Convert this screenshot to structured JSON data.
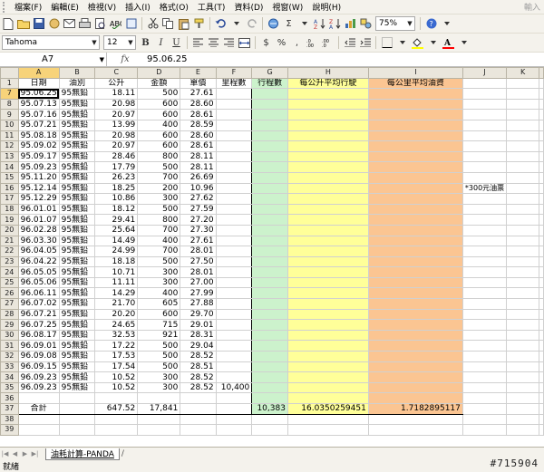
{
  "menubar": {
    "items": [
      "檔案(F)",
      "編輯(E)",
      "檢視(V)",
      "插入(I)",
      "格式(O)",
      "工具(T)",
      "資料(D)",
      "視窗(W)",
      "說明(H)"
    ],
    "ask_placeholder": "輸入"
  },
  "toolbar1": {
    "sigma": "Σ",
    "zoom": "75%"
  },
  "toolbar2": {
    "font": "Tahoma",
    "size": "12",
    "bold": "B",
    "italic": "I",
    "underline": "U",
    "currency": "$",
    "percent": "%",
    "comma": ","
  },
  "formula_bar": {
    "name_box": "A7",
    "fx": "fx",
    "formula": "95.06.25"
  },
  "grid": {
    "columns": [
      "A",
      "B",
      "C",
      "D",
      "E",
      "F",
      "G",
      "H",
      "I",
      "J",
      "K"
    ],
    "header_row": {
      "row": "1",
      "cells": [
        "日期",
        "油別",
        "公升",
        "金額",
        "單價",
        "里程數",
        "行程數",
        "每公升平均行駛",
        "每公里平均油資",
        "",
        ""
      ]
    },
    "rows": [
      {
        "row": "7",
        "date": "95.06.25",
        "fuel": "95無鉛",
        "liters": "18.11",
        "amount": "500",
        "price": "27.61",
        "mileage": "",
        "note": ""
      },
      {
        "row": "8",
        "date": "95.07.13",
        "fuel": "95無鉛",
        "liters": "20.98",
        "amount": "600",
        "price": "28.60",
        "mileage": "",
        "note": ""
      },
      {
        "row": "9",
        "date": "95.07.16",
        "fuel": "95無鉛",
        "liters": "20.97",
        "amount": "600",
        "price": "28.61",
        "mileage": "",
        "note": ""
      },
      {
        "row": "10",
        "date": "95.07.21",
        "fuel": "95無鉛",
        "liters": "13.99",
        "amount": "400",
        "price": "28.59",
        "mileage": "",
        "note": ""
      },
      {
        "row": "11",
        "date": "95.08.18",
        "fuel": "95無鉛",
        "liters": "20.98",
        "amount": "600",
        "price": "28.60",
        "mileage": "",
        "note": ""
      },
      {
        "row": "12",
        "date": "95.09.02",
        "fuel": "95無鉛",
        "liters": "20.97",
        "amount": "600",
        "price": "28.61",
        "mileage": "",
        "note": ""
      },
      {
        "row": "13",
        "date": "95.09.17",
        "fuel": "95無鉛",
        "liters": "28.46",
        "amount": "800",
        "price": "28.11",
        "mileage": "",
        "note": ""
      },
      {
        "row": "14",
        "date": "95.09.23",
        "fuel": "95無鉛",
        "liters": "17.79",
        "amount": "500",
        "price": "28.11",
        "mileage": "",
        "note": ""
      },
      {
        "row": "15",
        "date": "95.11.20",
        "fuel": "95無鉛",
        "liters": "26.23",
        "amount": "700",
        "price": "26.69",
        "mileage": "",
        "note": ""
      },
      {
        "row": "16",
        "date": "95.12.14",
        "fuel": "95無鉛",
        "liters": "18.25",
        "amount": "200",
        "price": "10.96",
        "mileage": "",
        "note": "*300元油票"
      },
      {
        "row": "17",
        "date": "95.12.29",
        "fuel": "95無鉛",
        "liters": "10.86",
        "amount": "300",
        "price": "27.62",
        "mileage": "",
        "note": ""
      },
      {
        "row": "18",
        "date": "96.01.01",
        "fuel": "95無鉛",
        "liters": "18.12",
        "amount": "500",
        "price": "27.59",
        "mileage": "",
        "note": ""
      },
      {
        "row": "19",
        "date": "96.01.07",
        "fuel": "95無鉛",
        "liters": "29.41",
        "amount": "800",
        "price": "27.20",
        "mileage": "",
        "note": ""
      },
      {
        "row": "20",
        "date": "96.02.28",
        "fuel": "95無鉛",
        "liters": "25.64",
        "amount": "700",
        "price": "27.30",
        "mileage": "",
        "note": ""
      },
      {
        "row": "21",
        "date": "96.03.30",
        "fuel": "95無鉛",
        "liters": "14.49",
        "amount": "400",
        "price": "27.61",
        "mileage": "",
        "note": ""
      },
      {
        "row": "22",
        "date": "96.04.05",
        "fuel": "95無鉛",
        "liters": "24.99",
        "amount": "700",
        "price": "28.01",
        "mileage": "",
        "note": ""
      },
      {
        "row": "23",
        "date": "96.04.22",
        "fuel": "95無鉛",
        "liters": "18.18",
        "amount": "500",
        "price": "27.50",
        "mileage": "",
        "note": ""
      },
      {
        "row": "24",
        "date": "96.05.05",
        "fuel": "95無鉛",
        "liters": "10.71",
        "amount": "300",
        "price": "28.01",
        "mileage": "",
        "note": ""
      },
      {
        "row": "25",
        "date": "96.05.06",
        "fuel": "95無鉛",
        "liters": "11.11",
        "amount": "300",
        "price": "27.00",
        "mileage": "",
        "note": ""
      },
      {
        "row": "26",
        "date": "96.06.11",
        "fuel": "95無鉛",
        "liters": "14.29",
        "amount": "400",
        "price": "27.99",
        "mileage": "",
        "note": ""
      },
      {
        "row": "27",
        "date": "96.07.02",
        "fuel": "95無鉛",
        "liters": "21.70",
        "amount": "605",
        "price": "27.88",
        "mileage": "",
        "note": ""
      },
      {
        "row": "28",
        "date": "96.07.21",
        "fuel": "95無鉛",
        "liters": "20.20",
        "amount": "600",
        "price": "29.70",
        "mileage": "",
        "note": ""
      },
      {
        "row": "29",
        "date": "96.07.25",
        "fuel": "95無鉛",
        "liters": "24.65",
        "amount": "715",
        "price": "29.01",
        "mileage": "",
        "note": ""
      },
      {
        "row": "30",
        "date": "96.08.17",
        "fuel": "95無鉛",
        "liters": "32.53",
        "amount": "921",
        "price": "28.31",
        "mileage": "",
        "note": ""
      },
      {
        "row": "31",
        "date": "96.09.01",
        "fuel": "95無鉛",
        "liters": "17.22",
        "amount": "500",
        "price": "29.04",
        "mileage": "",
        "note": ""
      },
      {
        "row": "32",
        "date": "96.09.08",
        "fuel": "95無鉛",
        "liters": "17.53",
        "amount": "500",
        "price": "28.52",
        "mileage": "",
        "note": ""
      },
      {
        "row": "33",
        "date": "96.09.15",
        "fuel": "95無鉛",
        "liters": "17.54",
        "amount": "500",
        "price": "28.51",
        "mileage": "",
        "note": ""
      },
      {
        "row": "34",
        "date": "96.09.23",
        "fuel": "95無鉛",
        "liters": "10.52",
        "amount": "300",
        "price": "28.52",
        "mileage": "",
        "note": ""
      },
      {
        "row": "35",
        "date": "96.09.23",
        "fuel": "95無鉛",
        "liters": "10.52",
        "amount": "300",
        "price": "28.52",
        "mileage": "10,400",
        "note": ""
      }
    ],
    "blank_row_36": "36",
    "totals": {
      "row": "37",
      "label": "合計",
      "liters": "647.52",
      "amount": "17,841",
      "trips": "10,383",
      "km_per_liter": "16.0350259451",
      "cost_per_km": "1.7182895117"
    },
    "trailing_rows": [
      "38",
      "39"
    ]
  },
  "tabs": {
    "sheet_name": "油耗計算-PANDA",
    "slash": "/"
  },
  "status": {
    "text": "就緒"
  },
  "watermark": "#715904",
  "colors": {
    "green_fill": "#ccf2cc",
    "yellow_fill": "#ffff99",
    "orange_fill": "#fbc592"
  }
}
